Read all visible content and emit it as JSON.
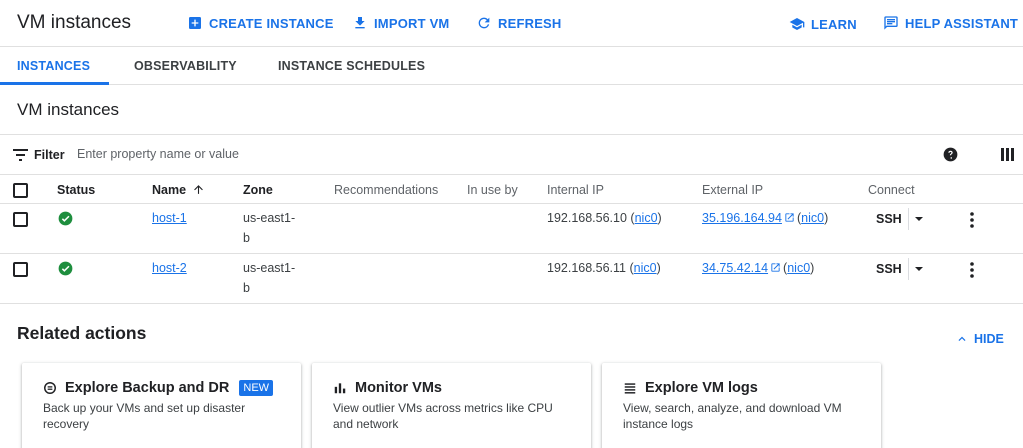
{
  "header": {
    "title": "VM instances",
    "create_label": "CREATE INSTANCE",
    "import_label": "IMPORT VM",
    "refresh_label": "REFRESH",
    "learn_label": "LEARN",
    "help_label": "HELP ASSISTANT"
  },
  "tabs": [
    {
      "label": "INSTANCES",
      "active": true
    },
    {
      "label": "OBSERVABILITY",
      "active": false
    },
    {
      "label": "INSTANCE SCHEDULES",
      "active": false
    }
  ],
  "section_title": "VM instances",
  "filter": {
    "label": "Filter",
    "placeholder": "Enter property name or value"
  },
  "table": {
    "columns": [
      "Status",
      "Name",
      "Zone",
      "Recommendations",
      "In use by",
      "Internal IP",
      "External IP",
      "Connect"
    ],
    "rows": [
      {
        "status": "running",
        "name": "host-1",
        "zone_line1": "us-east1-",
        "zone_line2": "b",
        "recommendations": "",
        "in_use_by": "",
        "internal_ip": "192.168.56.10",
        "internal_nic": "nic0",
        "external_ip": "35.196.164.94",
        "external_nic": "nic0",
        "connect": "SSH"
      },
      {
        "status": "running",
        "name": "host-2",
        "zone_line1": "us-east1-",
        "zone_line2": "b",
        "recommendations": "",
        "in_use_by": "",
        "internal_ip": "192.168.56.11",
        "internal_nic": "nic0",
        "external_ip": "34.75.42.14",
        "external_nic": "nic0",
        "connect": "SSH"
      }
    ]
  },
  "related": {
    "title": "Related actions",
    "hide_label": "HIDE",
    "cards": [
      {
        "title": "Explore Backup and DR",
        "badge": "NEW",
        "desc": "Back up your VMs and set up disaster recovery",
        "icon": "backup-icon"
      },
      {
        "title": "Monitor VMs",
        "badge": "",
        "desc": "View outlier VMs across metrics like CPU and network",
        "icon": "bar-chart-icon"
      },
      {
        "title": "Explore VM logs",
        "badge": "",
        "desc": "View, search, analyze, and download VM instance logs",
        "icon": "logs-icon"
      }
    ]
  },
  "colors": {
    "accent": "#1a73e8",
    "success": "#1e8e3e",
    "divider": "#e0e0e0"
  }
}
